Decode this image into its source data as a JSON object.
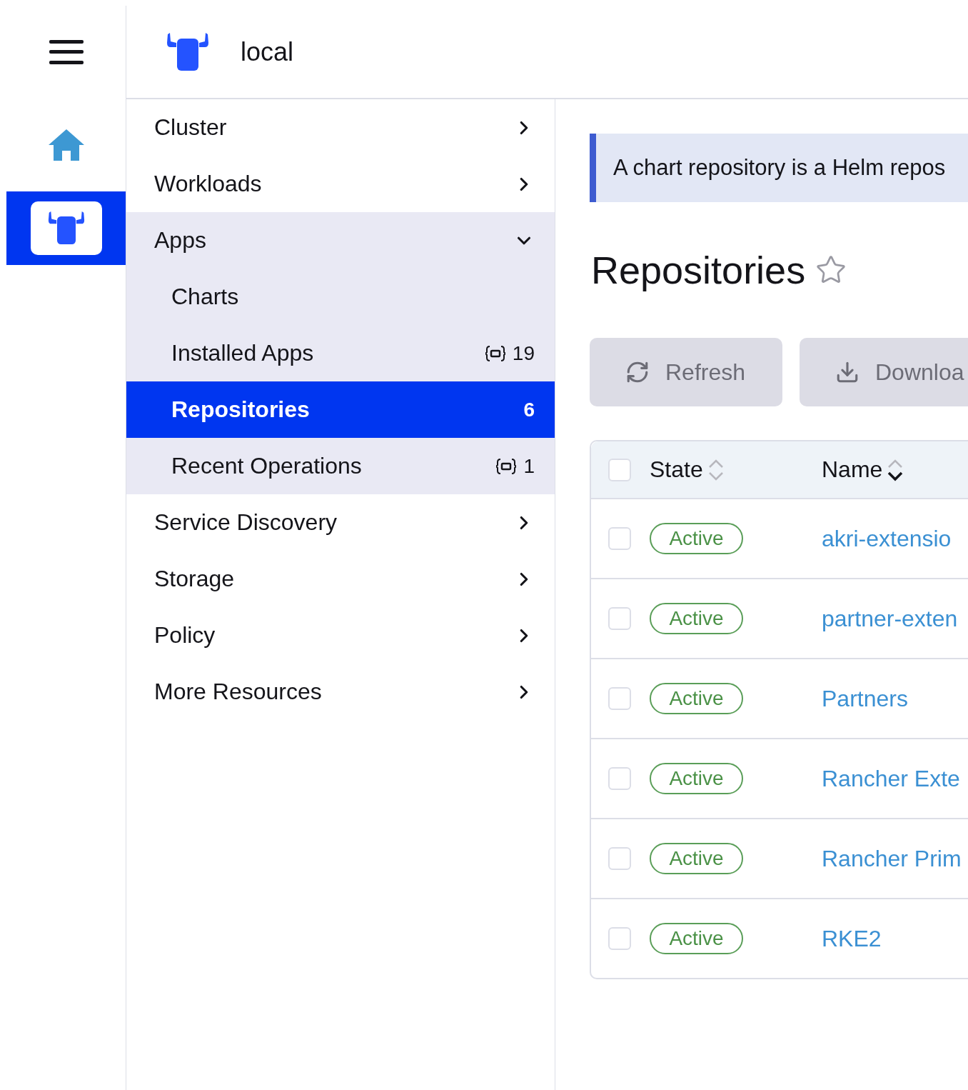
{
  "rail": [
    {
      "kind": "menu",
      "selected": false
    },
    {
      "kind": "home",
      "selected": false
    },
    {
      "kind": "cluster",
      "selected": true
    }
  ],
  "header": {
    "cluster_name": "local"
  },
  "nav": [
    {
      "label": "Cluster",
      "expanded": false
    },
    {
      "label": "Workloads",
      "expanded": false
    },
    {
      "label": "Apps",
      "expanded": true,
      "children": [
        {
          "label": "Charts",
          "selected": false
        },
        {
          "label": "Installed Apps",
          "selected": false,
          "count": "19",
          "namespaced": true
        },
        {
          "label": "Repositories",
          "selected": true,
          "count": "6",
          "namespaced": false
        },
        {
          "label": "Recent Operations",
          "selected": false,
          "count": "1",
          "namespaced": true
        }
      ]
    },
    {
      "label": "Service Discovery",
      "expanded": false
    },
    {
      "label": "Storage",
      "expanded": false
    },
    {
      "label": "Policy",
      "expanded": false
    },
    {
      "label": "More Resources",
      "expanded": false
    }
  ],
  "banner": {
    "text": "A chart repository is a Helm repos"
  },
  "page": {
    "title": "Repositories",
    "favorite": false
  },
  "buttons": [
    {
      "label": "Refresh",
      "kind": "refresh"
    },
    {
      "label": "Downloa",
      "kind": "download"
    }
  ],
  "table": {
    "select_all_checked": false,
    "columns": [
      {
        "label": "State",
        "sorted": false
      },
      {
        "label": "Name",
        "sorted": true
      }
    ],
    "rows": [
      {
        "checked": false,
        "state": "Active",
        "name": "akri-extensio"
      },
      {
        "checked": false,
        "state": "Active",
        "name": "partner-exten"
      },
      {
        "checked": false,
        "state": "Active",
        "name": "Partners"
      },
      {
        "checked": false,
        "state": "Active",
        "name": "Rancher Exte"
      },
      {
        "checked": false,
        "state": "Active",
        "name": "Rancher Prim"
      },
      {
        "checked": false,
        "state": "Active",
        "name": "RKE2"
      }
    ]
  }
}
